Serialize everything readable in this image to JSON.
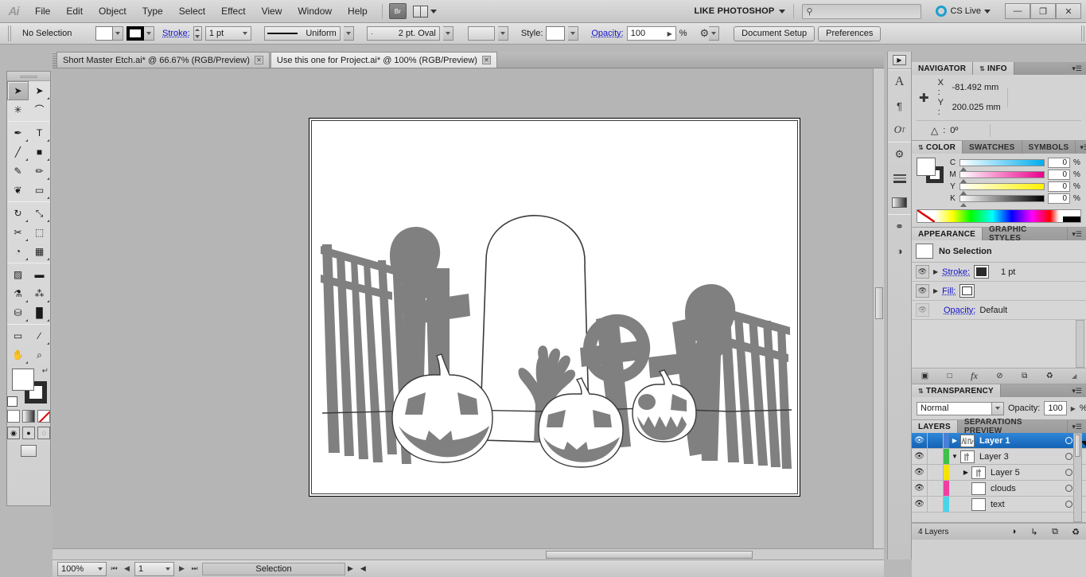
{
  "app": {
    "logo": "Ai",
    "menus": [
      "File",
      "Edit",
      "Object",
      "Type",
      "Select",
      "Effect",
      "View",
      "Window",
      "Help"
    ],
    "bridge_button": "Br",
    "arrange_icon": "arrange-documents-icon",
    "workspace": "LIKE PHOTOSHOP",
    "search_placeholder": "",
    "cslive": "CS Live",
    "window_buttons": {
      "minimize": "—",
      "restore": "❐",
      "close": "✕"
    }
  },
  "control_bar": {
    "selection_status": "No Selection",
    "fill_swatch_color": "#ffffff",
    "stroke_swatch_color": "#000000",
    "stroke_label": "Stroke:",
    "stroke_weight": "1 pt",
    "stroke_profile": "Uniform",
    "brush_definition": "2 pt. Oval",
    "style_label": "Style:",
    "opacity_label": "Opacity:",
    "opacity_value": "100",
    "opacity_unit": "%",
    "document_setup": "Document Setup",
    "preferences": "Preferences"
  },
  "tabs": [
    {
      "title": "Short Master Etch.ai* @ 66.67% (RGB/Preview)",
      "active": false,
      "close": "✕"
    },
    {
      "title": "Use this one for Project.ai* @ 100% (RGB/Preview)",
      "active": true,
      "close": "✕"
    }
  ],
  "toolbar": {
    "tools": [
      {
        "name": "selection-tool",
        "glyph": "➤",
        "selected": true,
        "flyout": false
      },
      {
        "name": "direct-selection-tool",
        "glyph": "➤",
        "selected": false,
        "flyout": true
      },
      {
        "name": "magic-wand-tool",
        "glyph": "✳",
        "selected": false,
        "flyout": false
      },
      {
        "name": "lasso-tool",
        "glyph": "⌒",
        "selected": false,
        "flyout": false
      },
      {
        "name": "pen-tool",
        "glyph": "✒",
        "selected": false,
        "flyout": true
      },
      {
        "name": "type-tool",
        "glyph": "T",
        "selected": false,
        "flyout": true
      },
      {
        "name": "line-segment-tool",
        "glyph": "╱",
        "selected": false,
        "flyout": true
      },
      {
        "name": "rectangle-tool",
        "glyph": "■",
        "selected": false,
        "flyout": true
      },
      {
        "name": "paintbrush-tool",
        "glyph": "✎",
        "selected": false,
        "flyout": false
      },
      {
        "name": "pencil-tool",
        "glyph": "✏",
        "selected": false,
        "flyout": true
      },
      {
        "name": "blob-brush-tool",
        "glyph": "❦",
        "selected": false,
        "flyout": false
      },
      {
        "name": "eraser-tool",
        "glyph": "▭",
        "selected": false,
        "flyout": true
      },
      {
        "name": "rotate-tool",
        "glyph": "↻",
        "selected": false,
        "flyout": true
      },
      {
        "name": "scale-tool",
        "glyph": "⤡",
        "selected": false,
        "flyout": true
      },
      {
        "name": "width-tool",
        "glyph": "✂",
        "selected": false,
        "flyout": true
      },
      {
        "name": "free-transform-tool",
        "glyph": "⬚",
        "selected": false,
        "flyout": false
      },
      {
        "name": "shape-builder-tool",
        "glyph": "◔",
        "selected": false,
        "flyout": true
      },
      {
        "name": "perspective-grid-tool",
        "glyph": "▦",
        "selected": false,
        "flyout": true
      },
      {
        "name": "mesh-tool",
        "glyph": "▨",
        "selected": false,
        "flyout": false
      },
      {
        "name": "gradient-tool",
        "glyph": "▬",
        "selected": false,
        "flyout": false
      },
      {
        "name": "eyedropper-tool",
        "glyph": "⚗",
        "selected": false,
        "flyout": true
      },
      {
        "name": "blend-tool",
        "glyph": "⁂",
        "selected": false,
        "flyout": true
      },
      {
        "name": "symbol-sprayer-tool",
        "glyph": "⛁",
        "selected": false,
        "flyout": true
      },
      {
        "name": "column-graph-tool",
        "glyph": "█",
        "selected": false,
        "flyout": true
      },
      {
        "name": "artboard-tool",
        "glyph": "▭",
        "selected": false,
        "flyout": false
      },
      {
        "name": "slice-tool",
        "glyph": "∕",
        "selected": false,
        "flyout": true
      },
      {
        "name": "hand-tool",
        "glyph": "✋",
        "selected": false,
        "flyout": true
      },
      {
        "name": "zoom-tool",
        "glyph": "⌕",
        "selected": false,
        "flyout": false
      }
    ],
    "fill_color": "#ffffff",
    "stroke_color": "#2b2b2b",
    "swap_icon": "swap-fill-stroke-icon",
    "default_icon": "default-fill-stroke-icon",
    "fill_modes": [
      "color-fill",
      "gradient-fill",
      "none-fill"
    ],
    "draw_modes": [
      "draw-normal",
      "draw-behind",
      "draw-inside"
    ],
    "screen_mode": "change-screen-mode"
  },
  "document": {
    "artwork_title": "halloween-graveyard-artwork",
    "shape_color": "#808080",
    "outline_color": "#3a3a3a"
  },
  "status_bar": {
    "zoom": "100%",
    "page": "1",
    "status": "Selection",
    "first_icon": "first-page-icon",
    "prev_icon": "previous-page-icon",
    "next_icon": "next-page-icon",
    "last_icon": "last-page-icon"
  },
  "dock_icons": [
    {
      "name": "expand-panels-icon",
      "glyph": "▶"
    },
    {
      "name": "character-panel-icon",
      "glyph": "A"
    },
    {
      "name": "paragraph-panel-icon",
      "glyph": "¶"
    },
    {
      "name": "opentype-panel-icon",
      "glyph": "O"
    },
    {
      "name": "brushes-panel-icon",
      "glyph": "⑁"
    },
    {
      "name": "align-panel-icon",
      "glyph": "≣"
    },
    {
      "name": "gradient-panel-icon",
      "glyph": "▬"
    },
    {
      "name": "links-panel-icon",
      "glyph": "⚭"
    },
    {
      "name": "image-trace-panel-icon",
      "glyph": "◑"
    }
  ],
  "panels": {
    "navigator_info": {
      "tabs": [
        {
          "label": "NAVIGATOR",
          "active": false
        },
        {
          "label": "INFO",
          "active": true
        }
      ],
      "cursor_icon": "crosshair-icon",
      "x_label": "X :",
      "x_value": "-81.492 mm",
      "y_label": "Y :",
      "y_value": "200.025 mm",
      "angle_icon": "angle-icon",
      "angle_label": ":",
      "angle_value": "0º"
    },
    "color": {
      "tabs": [
        {
          "label": "COLOR",
          "active": true
        },
        {
          "label": "SWATCHES",
          "active": false
        },
        {
          "label": "SYMBOLS",
          "active": false
        }
      ],
      "fill_color": "#ffffff",
      "stroke_color": "#2e2e2e",
      "sliders": [
        {
          "label": "C",
          "value": "0",
          "unit": "%",
          "ramp_end": "#00aeef"
        },
        {
          "label": "M",
          "value": "0",
          "unit": "%",
          "ramp_end": "#ec008c"
        },
        {
          "label": "Y",
          "value": "0",
          "unit": "%",
          "ramp_end": "#fff200"
        },
        {
          "label": "K",
          "value": "0",
          "unit": "%",
          "ramp_end": "#000000"
        }
      ]
    },
    "appearance": {
      "tabs": [
        {
          "label": "APPEARANCE",
          "active": true
        },
        {
          "label": "GRAPHIC STYLES",
          "active": false
        }
      ],
      "header": "No Selection",
      "rows": [
        {
          "label": "Stroke:",
          "value": "1 pt",
          "swatch": "#2b2b2b",
          "link": true,
          "has_disclosure": true
        },
        {
          "label": "Fill:",
          "value": "",
          "swatch": "#ffffff",
          "link": true,
          "has_disclosure": true
        },
        {
          "label": "Opacity:",
          "value": "Default",
          "swatch": "",
          "link": true,
          "has_disclosure": false
        }
      ],
      "footer_icons": [
        {
          "name": "add-new-stroke-icon",
          "glyph": "▣"
        },
        {
          "name": "add-new-fill-icon",
          "glyph": "□"
        },
        {
          "name": "add-new-effect-icon",
          "glyph": "fx"
        },
        {
          "name": "clear-appearance-icon",
          "glyph": "⊘"
        },
        {
          "name": "duplicate-item-icon",
          "glyph": "⧉"
        },
        {
          "name": "delete-item-icon",
          "glyph": "Ὕ1"
        }
      ]
    },
    "transparency": {
      "tabs": [
        {
          "label": "TRANSPARENCY",
          "active": true
        }
      ],
      "blend_mode": "Normal",
      "opacity_label": "Opacity:",
      "opacity_value": "100",
      "opacity_unit": "%"
    },
    "layers": {
      "tabs": [
        {
          "label": "LAYERS",
          "active": true
        },
        {
          "label": "SEPARATIONS PREVIEW",
          "active": false
        }
      ],
      "rows": [
        {
          "name": "Layer 1",
          "color": "#4a7fd4",
          "selected": true,
          "indent": 0,
          "has_arrow": true,
          "expanded": false,
          "visible": true,
          "thumb": "artwork"
        },
        {
          "name": "Layer 3",
          "color": "#3fc04a",
          "selected": false,
          "indent": 0,
          "has_arrow": true,
          "expanded": true,
          "visible": true,
          "thumb": "sublayer"
        },
        {
          "name": "Layer 5",
          "color": "#f2e300",
          "selected": false,
          "indent": 1,
          "has_arrow": true,
          "expanded": false,
          "visible": true,
          "thumb": "sublayer"
        },
        {
          "name": "clouds",
          "color": "#ef3fa0",
          "selected": false,
          "indent": 1,
          "has_arrow": false,
          "expanded": false,
          "visible": true,
          "thumb": "empty"
        },
        {
          "name": "text",
          "color": "#4ad4e8",
          "selected": false,
          "indent": 1,
          "has_arrow": false,
          "expanded": true,
          "visible": true,
          "thumb": "empty"
        }
      ],
      "footer_count": "4 Layers",
      "footer_icons": [
        {
          "name": "make-clipping-mask-icon",
          "glyph": "◔"
        },
        {
          "name": "create-new-sublayer-icon",
          "glyph": "↳"
        },
        {
          "name": "create-new-layer-icon",
          "glyph": "⧉"
        },
        {
          "name": "delete-selection-icon",
          "glyph": "Ὕ1"
        }
      ]
    }
  }
}
